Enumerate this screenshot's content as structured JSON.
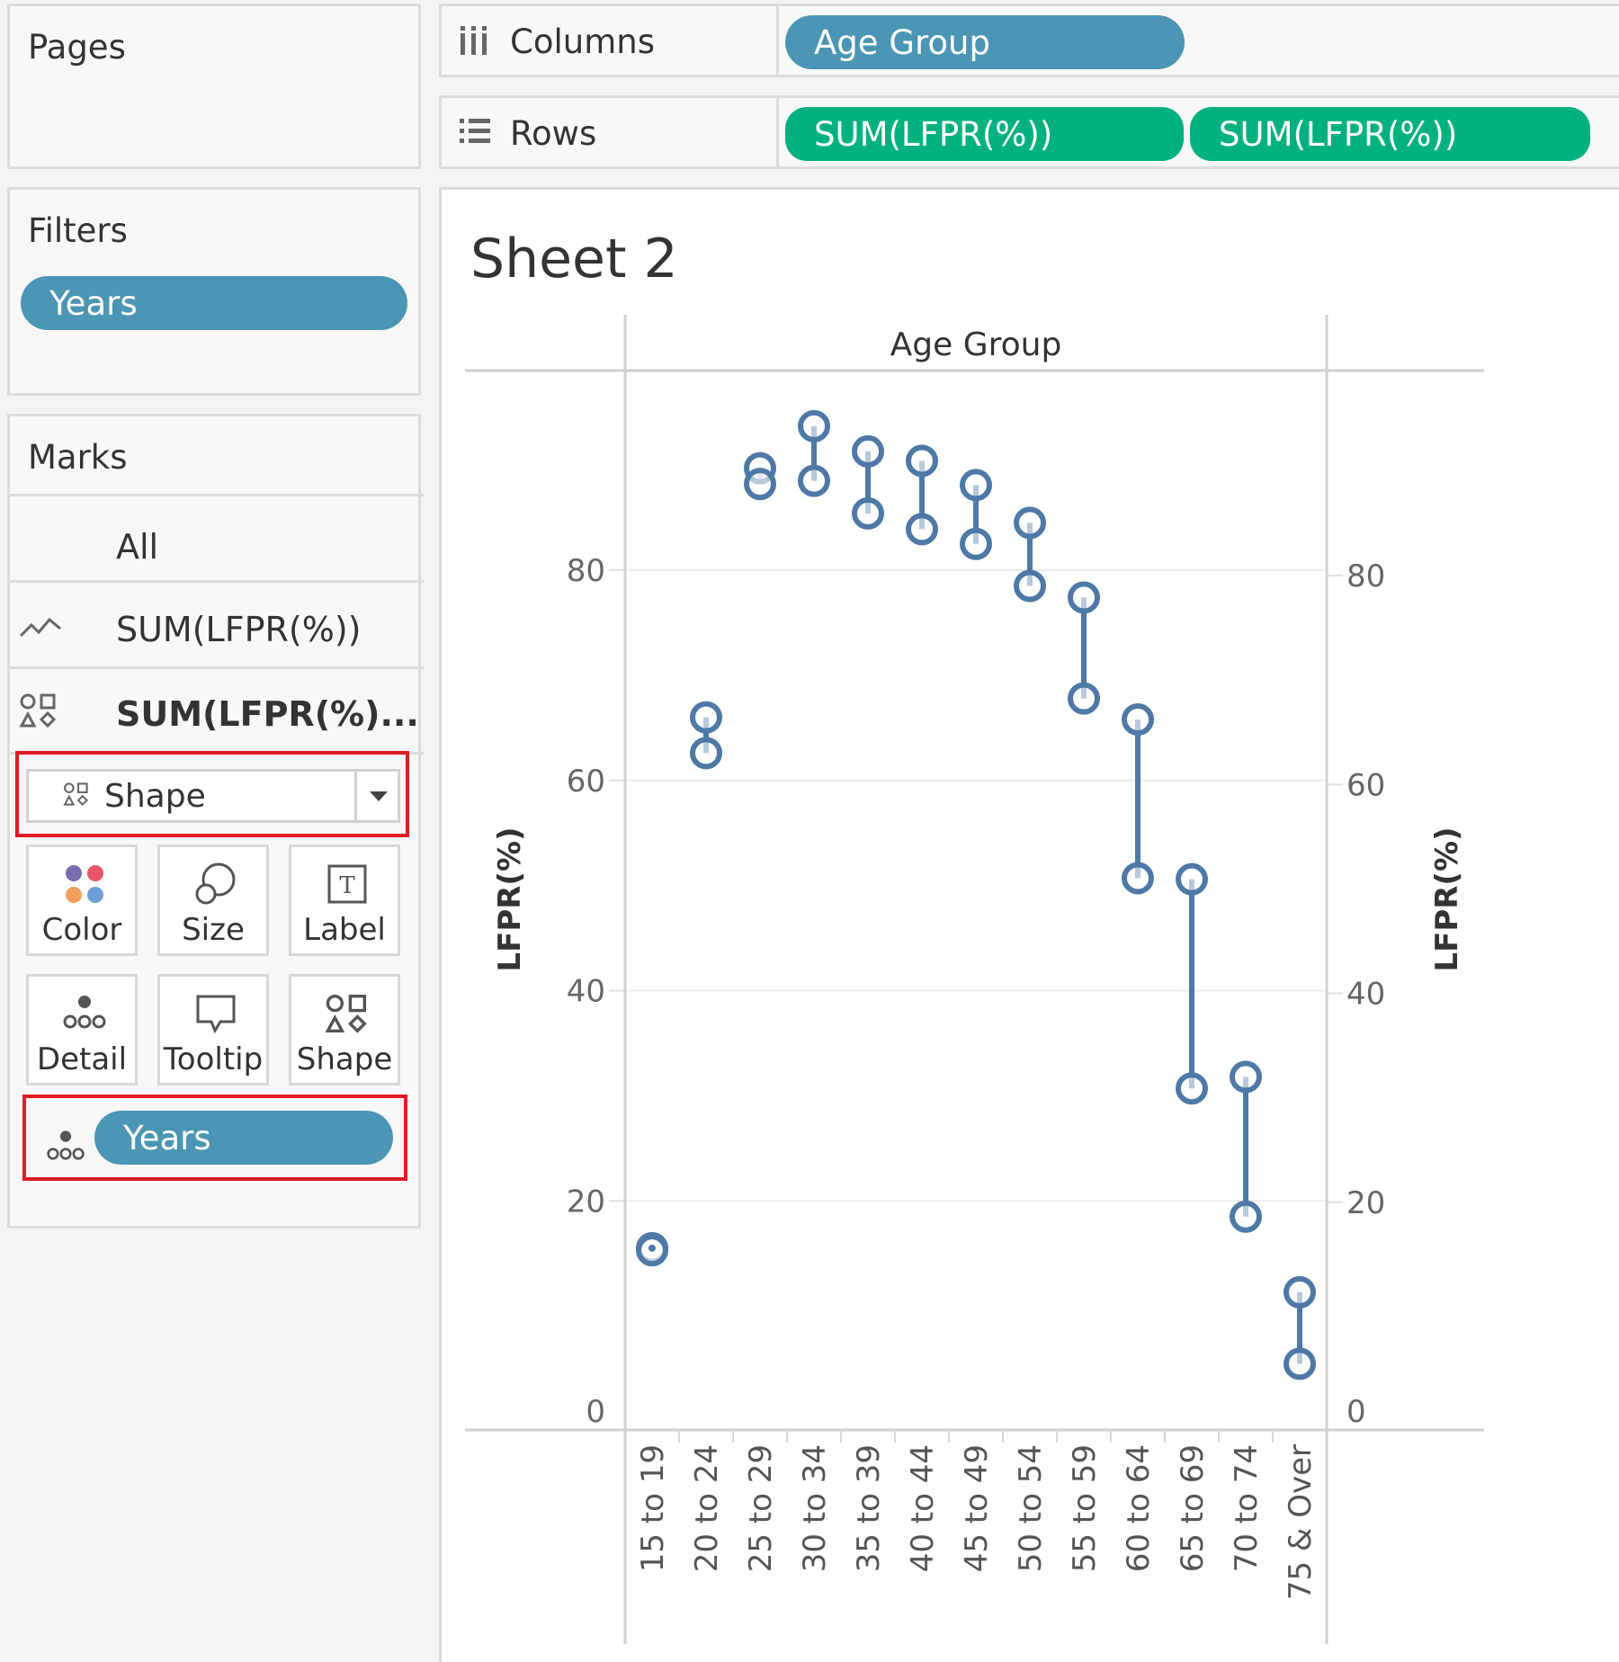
{
  "shelves": {
    "pages_title": "Pages",
    "filters_title": "Filters",
    "filter_pill": "Years",
    "marks_title": "Marks",
    "columns_label": "Columns",
    "rows_label": "Rows",
    "columns_pill": "Age Group",
    "rows_pills": [
      "SUM(LFPR(%))",
      "SUM(LFPR(%))"
    ]
  },
  "marks": {
    "all_label": "All",
    "line_card_label": "SUM(LFPR(%))",
    "shape_card_label": "SUM(LFPR(%)...",
    "mark_type_selected": "Shape",
    "buttons": [
      "Color",
      "Size",
      "Label",
      "Detail",
      "Tooltip",
      "Shape"
    ],
    "detail_pill": "Years"
  },
  "sheet_title": "Sheet 2",
  "chart_data": {
    "type": "dumbbell",
    "title": "Sheet 2",
    "column_header": "Age Group",
    "ylabel_left": "LFPR(%)",
    "ylabel_right": "LFPR(%)",
    "ylim": [
      0,
      95
    ],
    "yticks": [
      0,
      20,
      40,
      60,
      80
    ],
    "grid": true,
    "mark_color": "#4e79a7",
    "categories": [
      "15 to 19",
      "20 to 24",
      "25 to 29",
      "30 to 34",
      "35 to 39",
      "40 to 44",
      "45 to 49",
      "50 to 54",
      "55 to 59",
      "60 to 64",
      "65 to 69",
      "70 to 74",
      "75 & Over"
    ],
    "high": [
      15.5,
      66.0,
      89.7,
      93.7,
      91.3,
      90.4,
      88.1,
      84.5,
      77.4,
      65.8,
      50.6,
      31.8,
      11.3
    ],
    "low": [
      15.3,
      62.6,
      88.2,
      88.5,
      85.4,
      83.9,
      82.5,
      78.5,
      67.8,
      50.7,
      30.7,
      18.5,
      4.5
    ]
  }
}
